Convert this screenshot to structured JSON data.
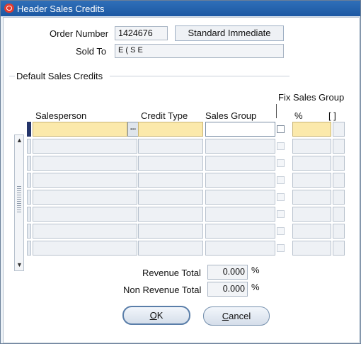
{
  "window": {
    "title": "Header Sales Credits"
  },
  "header": {
    "order_number_label": "Order Number",
    "order_number_value": "1424676",
    "order_type_value": "Standard Immediate",
    "sold_to_label": "Sold To",
    "sold_to_value": "E          (                                    S       E"
  },
  "section": {
    "title": "Default Sales Credits"
  },
  "grid": {
    "fix_sales_group_label": "Fix Sales Group",
    "columns": {
      "salesperson": "Salesperson",
      "credit_type": "Credit Type",
      "sales_group": "Sales Group",
      "percent": "%",
      "more": "[ ]"
    },
    "lov_button": "...",
    "row_count": 8
  },
  "totals": {
    "revenue_label": "Revenue Total",
    "revenue_value": "0.000",
    "revenue_unit": "%",
    "non_revenue_label": "Non Revenue Total",
    "non_revenue_value": "0.000",
    "non_revenue_unit": "%"
  },
  "buttons": {
    "ok_mnemonic": "O",
    "ok_rest": "K",
    "cancel_mnemonic": "C",
    "cancel_rest": "ancel"
  },
  "colors": {
    "title_bar": "#1c58a3",
    "required_field": "#fbe9ab",
    "current_record": "#24356a"
  }
}
